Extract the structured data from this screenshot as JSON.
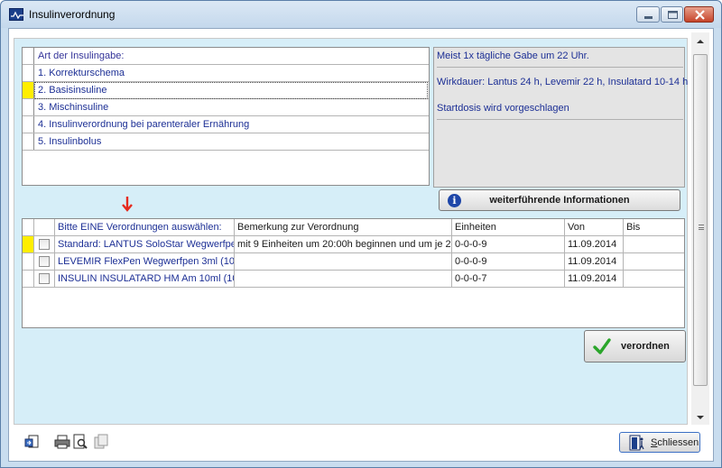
{
  "window": {
    "title": "Insulinverordnung",
    "minimize": "minimize",
    "maximize": "maximize",
    "close": "close"
  },
  "art": {
    "header": "Art der Insulingabe:",
    "items": [
      {
        "label": "1. Korrekturschema",
        "selected": false
      },
      {
        "label": "2. Basisinsuline",
        "selected": true
      },
      {
        "label": "3. Mischinsuline",
        "selected": false
      },
      {
        "label": "4. Insulinverordnung bei parenteraler Ernährung",
        "selected": false
      },
      {
        "label": "5. Insulinbolus",
        "selected": false
      }
    ]
  },
  "info": {
    "line1": "Meist 1x tägliche Gabe um 22 Uhr.",
    "line2": "Wirkdauer: Lantus 24 h, Levemir 22 h, Insulatard 10-14 h",
    "line3": "Startdosis wird vorgeschlagen",
    "button": "weiterführende Informationen"
  },
  "table": {
    "columns": [
      "Bitte EINE Verordnungen auswählen:",
      "Bemerkung zur Verordnung",
      "Einheiten",
      "Von",
      "Bis"
    ],
    "rows": [
      {
        "name": "Standard: LANTUS SoloStar Wegwerfpe",
        "remark": "mit 9 Einheiten um 20:00h beginnen und um je 2 Eir",
        "units": "0-0-0-9",
        "from": "11.09.2014",
        "to": "",
        "active": true
      },
      {
        "name": "LEVEMIR FlexPen  Wegwerfpen 3ml (100",
        "remark": "",
        "units": "0-0-0-9",
        "from": "11.09.2014",
        "to": "",
        "active": false
      },
      {
        "name": "INSULIN INSULATARD HM Am 10ml (100E",
        "remark": "",
        "units": "0-0-0-7",
        "from": "11.09.2014",
        "to": "",
        "active": false
      }
    ]
  },
  "buttons": {
    "verordnen": "verordnen",
    "close_label": "Schliessen"
  },
  "colors": {
    "panel_bg": "#d6eef8",
    "selection_marker": "#ffee00",
    "text_blue": "#1c2f95",
    "arrow_red": "#e52a1e",
    "check_green": "#2aa52a"
  }
}
